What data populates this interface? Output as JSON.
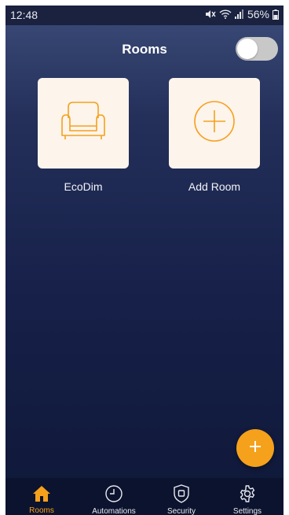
{
  "status_bar": {
    "time": "12:48",
    "battery": "56%"
  },
  "header": {
    "title": "Rooms",
    "toggle_on": false
  },
  "rooms": [
    {
      "label": "EcoDim",
      "icon": "armchair-icon"
    },
    {
      "label": "Add Room",
      "icon": "plus-circle-icon"
    }
  ],
  "fab": {
    "icon": "plus-icon"
  },
  "nav": {
    "items": [
      {
        "label": "Rooms",
        "icon": "home-icon",
        "active": true
      },
      {
        "label": "Automations",
        "icon": "clock-icon",
        "active": false
      },
      {
        "label": "Security",
        "icon": "shield-icon",
        "active": false
      },
      {
        "label": "Settings",
        "icon": "gear-icon",
        "active": false
      }
    ]
  },
  "colors": {
    "accent": "#f5a11c",
    "card_bg": "#fdf4ec",
    "background_top": "#3b4b78",
    "background_bottom": "#0f1838"
  }
}
